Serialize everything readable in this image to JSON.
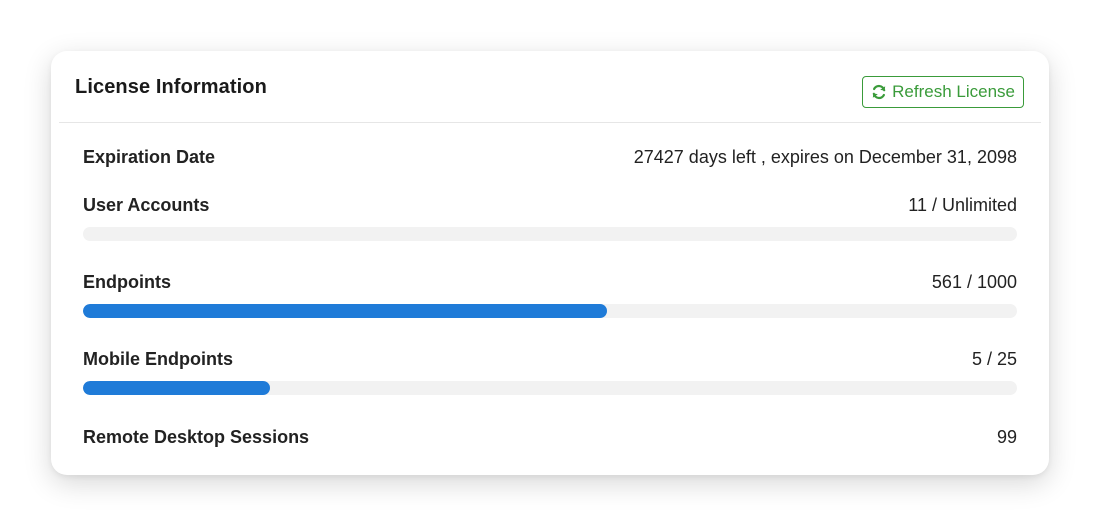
{
  "card": {
    "title": "License Information",
    "refresh_button": {
      "label": "Refresh License",
      "icon": "refresh-icon",
      "color": "#3a9b3a"
    }
  },
  "rows": {
    "expiration": {
      "label": "Expiration Date",
      "value": "27427 days left , expires on December 31, 2098"
    },
    "user_accounts": {
      "label": "User Accounts",
      "value": "11 / Unlimited",
      "progress_fraction": 0
    },
    "endpoints": {
      "label": "Endpoints",
      "value": "561 / 1000",
      "progress_fraction": 0.561
    },
    "mobile_endpoints": {
      "label": "Mobile Endpoints",
      "value": "5 / 25",
      "progress_fraction": 0.2
    },
    "remote_desktop": {
      "label": "Remote Desktop Sessions",
      "value": "99"
    }
  },
  "colors": {
    "bar_fill": "#1f7bd8",
    "bar_track": "#f2f2f2",
    "accent_green": "#3a9b3a"
  }
}
